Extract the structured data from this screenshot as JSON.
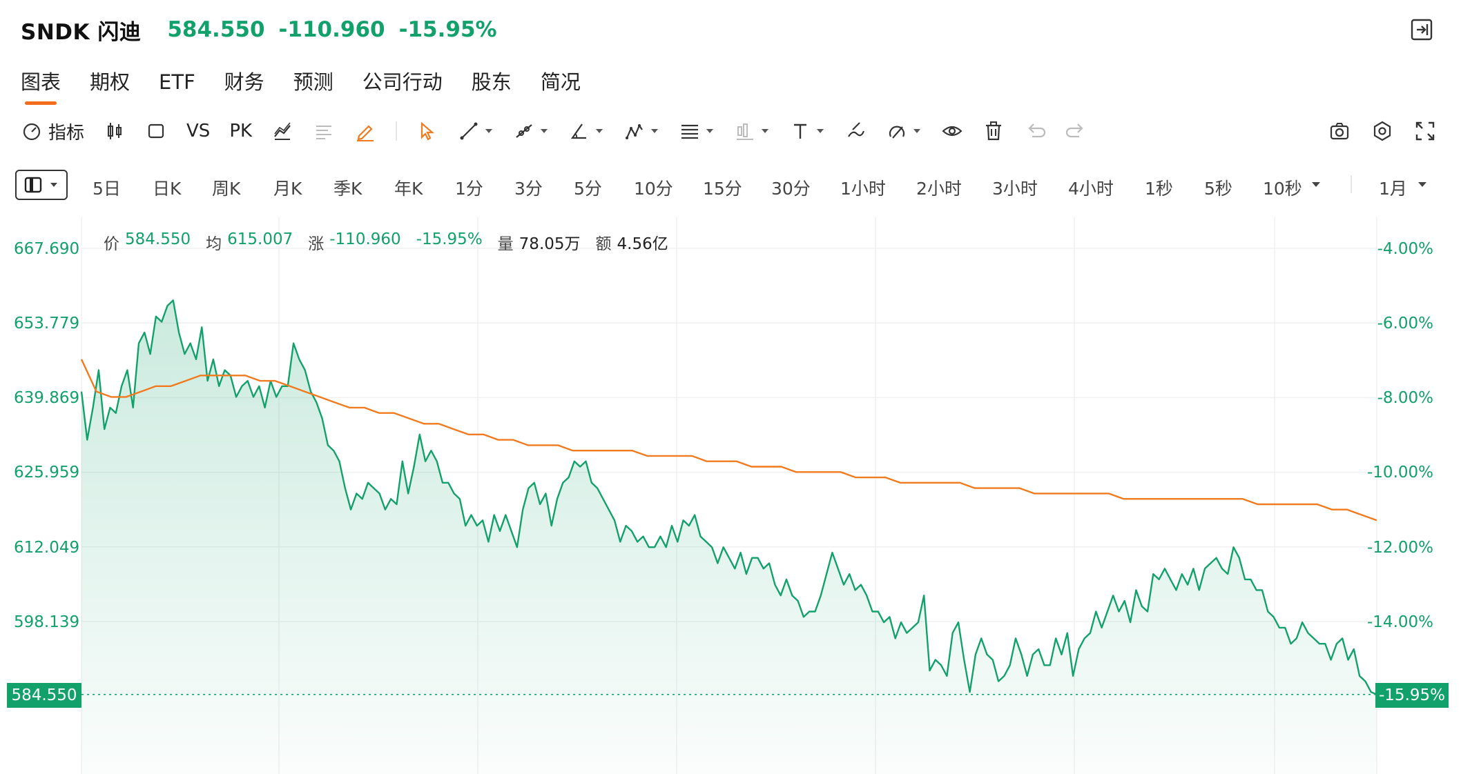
{
  "header": {
    "symbol": "SNDK 闪迪",
    "price": "584.550",
    "change": "-110.960",
    "change_pct": "-15.95%"
  },
  "tabs": [
    {
      "label": "图表",
      "active": true
    },
    {
      "label": "期权"
    },
    {
      "label": "ETF"
    },
    {
      "label": "财务"
    },
    {
      "label": "预测"
    },
    {
      "label": "公司行动"
    },
    {
      "label": "股东"
    },
    {
      "label": "简况"
    }
  ],
  "toolbar": {
    "indicator_label": "指标",
    "vs_label": "VS",
    "pk_label": "PK",
    "tools": [
      "candlestick-icon",
      "rectangle-icon",
      "compare-icon",
      "pencil-icon",
      "cursor-icon",
      "line-icon",
      "ray-icon",
      "angle-icon",
      "pattern-icon",
      "fib-icon",
      "measure-icon",
      "text-icon",
      "brush-icon",
      "magnet-icon",
      "eye-icon",
      "trash-icon",
      "undo-icon",
      "redo-icon",
      "camera-icon",
      "settings-icon",
      "fullscreen-icon"
    ]
  },
  "periods": [
    "5日",
    "日K",
    "周K",
    "月K",
    "季K",
    "年K",
    "1分",
    "3分",
    "5分",
    "10分",
    "15分",
    "30分",
    "1小时",
    "2小时",
    "3小时",
    "4小时",
    "1秒",
    "5秒",
    "10秒"
  ],
  "period_range": "1月",
  "info_bar": {
    "price_label": "价",
    "price": "584.550",
    "avg_label": "均",
    "avg": "615.007",
    "chg_label": "涨",
    "chg": "-110.960",
    "chg_pct": "-15.95%",
    "vol_label": "量",
    "vol": "78.05万",
    "amt_label": "额",
    "amt": "4.56亿"
  },
  "colors": {
    "up_green": "#12a06b",
    "avg_orange": "#f07a1d",
    "accent": "#f36b1c"
  },
  "chart_data": {
    "type": "line",
    "y_left_ticks": [
      "667.690",
      "653.779",
      "639.869",
      "625.959",
      "612.049",
      "598.139"
    ],
    "y_right_ticks": [
      "-4.00%",
      "-6.00%",
      "-8.00%",
      "-10.00%",
      "-12.00%",
      "-14.00%"
    ],
    "current_price_label": "584.550",
    "current_pct_label": "-15.95%",
    "ylim": [
      567.5,
      672
    ],
    "series": [
      {
        "name": "价",
        "values": [
          641,
          632,
          638,
          645,
          634,
          638,
          637,
          642,
          645,
          638,
          650,
          652,
          648,
          655,
          654,
          657,
          658,
          652,
          648,
          650,
          647,
          653,
          643,
          647,
          642,
          645,
          644,
          640,
          642,
          643,
          640,
          642,
          638,
          643,
          640,
          642,
          642,
          650,
          647,
          645,
          641,
          639,
          636,
          631,
          630,
          628,
          623,
          619,
          622,
          621,
          624,
          623,
          622,
          619,
          621,
          620,
          628,
          622,
          627,
          633,
          628,
          630,
          628,
          624,
          624,
          622,
          621,
          616,
          618,
          616,
          617,
          613,
          618,
          615,
          618,
          615,
          612,
          619,
          623,
          624,
          620,
          622,
          616,
          621,
          624,
          625,
          628,
          627,
          628,
          624,
          623,
          621,
          619,
          617,
          613,
          616,
          615,
          613,
          614,
          612,
          612,
          614,
          612,
          616,
          613,
          617,
          616,
          618,
          614,
          613,
          612,
          609,
          612,
          610,
          608,
          611,
          607,
          610,
          610,
          608,
          609,
          605,
          603,
          606,
          603,
          602,
          599,
          600,
          600,
          603,
          607,
          611,
          608,
          605,
          607,
          604,
          605,
          603,
          600,
          600,
          598,
          599,
          595,
          598,
          596,
          597,
          598,
          603,
          589,
          591,
          590,
          588,
          596,
          598,
          591,
          585,
          592,
          595,
          592,
          591,
          587,
          588,
          590,
          595,
          592,
          588,
          592,
          593,
          590,
          590,
          595,
          592,
          596,
          588,
          593,
          595,
          596,
          600,
          597,
          600,
          603,
          600,
          602,
          598,
          604,
          601,
          600,
          607,
          606,
          608,
          606,
          604,
          607,
          605,
          608,
          604,
          608,
          609,
          610,
          608,
          607,
          612,
          610,
          606,
          606,
          604,
          604,
          600,
          599,
          597,
          597,
          594,
          595,
          598,
          596,
          595,
          594,
          594,
          591,
          594,
          595,
          591,
          593,
          588,
          587,
          585,
          584.55
        ]
      },
      {
        "name": "均",
        "values": [
          647,
          641,
          640,
          640,
          641,
          642,
          642,
          643,
          644,
          644,
          644,
          644,
          643,
          643,
          642,
          641,
          640,
          639,
          638,
          638,
          637,
          637,
          636,
          635,
          635,
          634,
          633,
          633,
          632,
          632,
          631,
          631,
          631,
          630,
          630,
          630,
          630,
          630,
          629,
          629,
          629,
          629,
          628,
          628,
          628,
          627,
          627,
          627,
          626,
          626,
          626,
          626,
          625,
          625,
          625,
          624,
          624,
          624,
          624,
          624,
          623,
          623,
          623,
          623,
          622,
          622,
          622,
          622,
          622,
          622,
          621,
          621,
          621,
          621,
          621,
          621,
          621,
          621,
          621,
          620,
          620,
          620,
          620,
          620,
          619,
          619,
          618,
          617
        ]
      }
    ]
  }
}
